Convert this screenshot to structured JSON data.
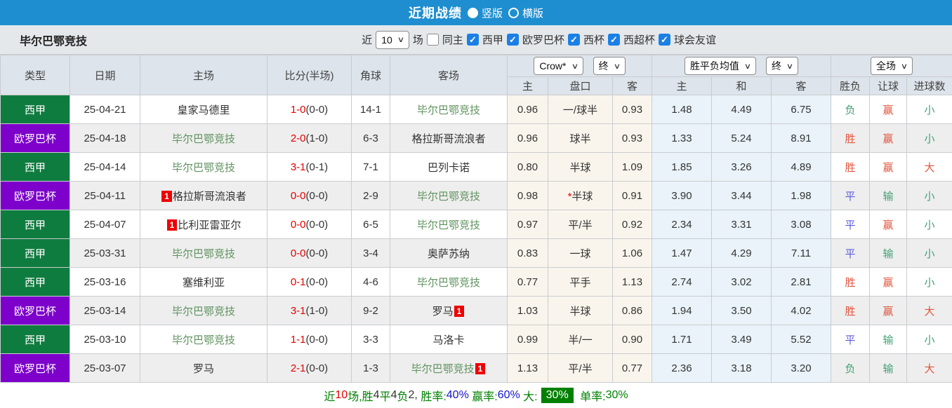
{
  "topbar": {
    "title": "近期战绩",
    "radio_vertical": "竖版",
    "radio_horizontal": "横版"
  },
  "filterbar": {
    "team": "毕尔巴鄂竞技",
    "recent_label": "近",
    "recent_value": "10",
    "games_label": "场",
    "checks": [
      {
        "label": "同主",
        "box_class": "cb"
      },
      {
        "label": "西甲",
        "box_class": "cb checked"
      },
      {
        "label": "欧罗巴杯",
        "box_class": "cb checked"
      },
      {
        "label": "西杯",
        "box_class": "cb checked"
      },
      {
        "label": "西超杯",
        "box_class": "cb checked"
      },
      {
        "label": "球会友谊",
        "box_class": "cb checked"
      }
    ]
  },
  "table": {
    "headers": {
      "type": "类型",
      "date": "日期",
      "home": "主场",
      "score": "比分(半场)",
      "corner": "角球",
      "away": "客场",
      "odds_select": "Crow*",
      "odds_final_select": "终",
      "odds_cols": [
        "主",
        "盘口",
        "客"
      ],
      "avg_select": "胜平负均值",
      "avg_final_select": "终",
      "avg_cols": [
        "主",
        "和",
        "客"
      ],
      "full_select": "全场",
      "result_cols": [
        "胜负",
        "让球",
        "进球数"
      ]
    },
    "rows": [
      {
        "type": "西甲",
        "type_class": "lg-green",
        "date": "25-04-21",
        "home_badge": "",
        "home": "皇家马德里",
        "home_class": "tn",
        "score": "1-0",
        "half": "(0-0)",
        "corner": "14-1",
        "away": "毕尔巴鄂竞技",
        "away_badge": "",
        "away_class": "self",
        "odds_home": "0.96",
        "handicap_star": "",
        "handicap": "一/球半",
        "odds_away": "0.93",
        "avg_win": "1.48",
        "avg_draw": "4.49",
        "avg_lose": "6.75",
        "result": "负",
        "result_class": "t-green",
        "letball": "赢",
        "letball_class": "t-red",
        "goals": "小",
        "goals_class": "t-green"
      },
      {
        "type": "欧罗巴杯",
        "type_class": "lg-purple",
        "date": "25-04-18",
        "home_badge": "",
        "home": "毕尔巴鄂竞技",
        "home_class": "self",
        "score": "2-0",
        "half": "(1-0)",
        "corner": "6-3",
        "away": "格拉斯哥流浪者",
        "away_badge": "",
        "away_class": "tn",
        "odds_home": "0.96",
        "handicap_star": "",
        "handicap": "球半",
        "odds_away": "0.93",
        "avg_win": "1.33",
        "avg_draw": "5.24",
        "avg_lose": "8.91",
        "result": "胜",
        "result_class": "t-red",
        "letball": "赢",
        "letball_class": "t-red",
        "goals": "小",
        "goals_class": "t-green"
      },
      {
        "type": "西甲",
        "type_class": "lg-green",
        "date": "25-04-14",
        "home_badge": "",
        "home": "毕尔巴鄂竞技",
        "home_class": "self",
        "score": "3-1",
        "half": "(0-1)",
        "corner": "7-1",
        "away": "巴列卡诺",
        "away_badge": "",
        "away_class": "tn",
        "odds_home": "0.80",
        "handicap_star": "",
        "handicap": "半球",
        "odds_away": "1.09",
        "avg_win": "1.85",
        "avg_draw": "3.26",
        "avg_lose": "4.89",
        "result": "胜",
        "result_class": "t-red",
        "letball": "赢",
        "letball_class": "t-red",
        "goals": "大",
        "goals_class": "t-red"
      },
      {
        "type": "欧罗巴杯",
        "type_class": "lg-purple",
        "date": "25-04-11",
        "home_badge": "1",
        "home": "格拉斯哥流浪者",
        "home_class": "tn",
        "score": "0-0",
        "half": "(0-0)",
        "corner": "2-9",
        "away": "毕尔巴鄂竞技",
        "away_badge": "",
        "away_class": "self",
        "odds_home": "0.98",
        "handicap_star": "*",
        "handicap": "半球",
        "odds_away": "0.91",
        "avg_win": "3.90",
        "avg_draw": "3.44",
        "avg_lose": "1.98",
        "result": "平",
        "result_class": "t-blue",
        "letball": "输",
        "letball_class": "t-green",
        "goals": "小",
        "goals_class": "t-green"
      },
      {
        "type": "西甲",
        "type_class": "lg-green",
        "date": "25-04-07",
        "home_badge": "1",
        "home": "比利亚雷亚尔",
        "home_class": "tn",
        "score": "0-0",
        "half": "(0-0)",
        "corner": "6-5",
        "away": "毕尔巴鄂竞技",
        "away_badge": "",
        "away_class": "self",
        "odds_home": "0.97",
        "handicap_star": "",
        "handicap": "平/半",
        "odds_away": "0.92",
        "avg_win": "2.34",
        "avg_draw": "3.31",
        "avg_lose": "3.08",
        "result": "平",
        "result_class": "t-blue",
        "letball": "赢",
        "letball_class": "t-red",
        "goals": "小",
        "goals_class": "t-green"
      },
      {
        "type": "西甲",
        "type_class": "lg-green",
        "date": "25-03-31",
        "home_badge": "",
        "home": "毕尔巴鄂竞技",
        "home_class": "self",
        "score": "0-0",
        "half": "(0-0)",
        "corner": "3-4",
        "away": "奥萨苏纳",
        "away_badge": "",
        "away_class": "tn",
        "odds_home": "0.83",
        "handicap_star": "",
        "handicap": "一球",
        "odds_away": "1.06",
        "avg_win": "1.47",
        "avg_draw": "4.29",
        "avg_lose": "7.11",
        "result": "平",
        "result_class": "t-blue",
        "letball": "输",
        "letball_class": "t-green",
        "goals": "小",
        "goals_class": "t-green"
      },
      {
        "type": "西甲",
        "type_class": "lg-green",
        "date": "25-03-16",
        "home_badge": "",
        "home": "塞维利亚",
        "home_class": "tn",
        "score": "0-1",
        "half": "(0-0)",
        "corner": "4-6",
        "away": "毕尔巴鄂竞技",
        "away_badge": "",
        "away_class": "self",
        "odds_home": "0.77",
        "handicap_star": "",
        "handicap": "平手",
        "odds_away": "1.13",
        "avg_win": "2.74",
        "avg_draw": "3.02",
        "avg_lose": "2.81",
        "result": "胜",
        "result_class": "t-red",
        "letball": "赢",
        "letball_class": "t-red",
        "goals": "小",
        "goals_class": "t-green"
      },
      {
        "type": "欧罗巴杯",
        "type_class": "lg-purple",
        "date": "25-03-14",
        "home_badge": "",
        "home": "毕尔巴鄂竞技",
        "home_class": "self",
        "score": "3-1",
        "half": "(1-0)",
        "corner": "9-2",
        "away": "罗马",
        "away_badge": "1",
        "away_class": "tn",
        "odds_home": "1.03",
        "handicap_star": "",
        "handicap": "半球",
        "odds_away": "0.86",
        "avg_win": "1.94",
        "avg_draw": "3.50",
        "avg_lose": "4.02",
        "result": "胜",
        "result_class": "t-red",
        "letball": "赢",
        "letball_class": "t-red",
        "goals": "大",
        "goals_class": "t-red"
      },
      {
        "type": "西甲",
        "type_class": "lg-green",
        "date": "25-03-10",
        "home_badge": "",
        "home": "毕尔巴鄂竞技",
        "home_class": "self",
        "score": "1-1",
        "half": "(0-0)",
        "corner": "3-3",
        "away": "马洛卡",
        "away_badge": "",
        "away_class": "tn",
        "odds_home": "0.99",
        "handicap_star": "",
        "handicap": "半/一",
        "odds_away": "0.90",
        "avg_win": "1.71",
        "avg_draw": "3.49",
        "avg_lose": "5.52",
        "result": "平",
        "result_class": "t-blue",
        "letball": "输",
        "letball_class": "t-green",
        "goals": "小",
        "goals_class": "t-green"
      },
      {
        "type": "欧罗巴杯",
        "type_class": "lg-purple",
        "date": "25-03-07",
        "home_badge": "",
        "home": "罗马",
        "home_class": "tn",
        "score": "2-1",
        "half": "(0-0)",
        "corner": "1-3",
        "away": "毕尔巴鄂竞技",
        "away_badge": "1",
        "away_class": "self",
        "odds_home": "1.13",
        "handicap_star": "",
        "handicap": "平/半",
        "odds_away": "0.77",
        "avg_win": "2.36",
        "avg_draw": "3.18",
        "avg_lose": "3.20",
        "result": "负",
        "result_class": "t-green",
        "letball": "输",
        "letball_class": "t-green",
        "goals": "大",
        "goals_class": "t-red"
      }
    ]
  },
  "footer": {
    "segments": [
      {
        "text": "近",
        "cls": "fg"
      },
      {
        "text": "10",
        "cls": "fr"
      },
      {
        "text": "场,",
        "cls": "fg"
      },
      {
        "text": "胜",
        "cls": "fg"
      },
      {
        "text": "4",
        "cls": "fd"
      },
      {
        "text": "平",
        "cls": "fg"
      },
      {
        "text": "4",
        "cls": "fd"
      },
      {
        "text": "负",
        "cls": "fg"
      },
      {
        "text": "2",
        "cls": "fd"
      },
      {
        "text": ", ",
        "cls": "fd"
      },
      {
        "text": "胜率:",
        "cls": "fg"
      },
      {
        "text": "40%",
        "cls": "fb"
      },
      {
        "text": " 赢率:",
        "cls": "fg"
      },
      {
        "text": "60%",
        "cls": "fb"
      },
      {
        "text": " 大:",
        "cls": "fg"
      },
      {
        "text": "30%",
        "cls": "fbadge"
      },
      {
        "text": " 单率:",
        "cls": "fg"
      },
      {
        "text": "30%",
        "cls": "fg"
      }
    ]
  }
}
